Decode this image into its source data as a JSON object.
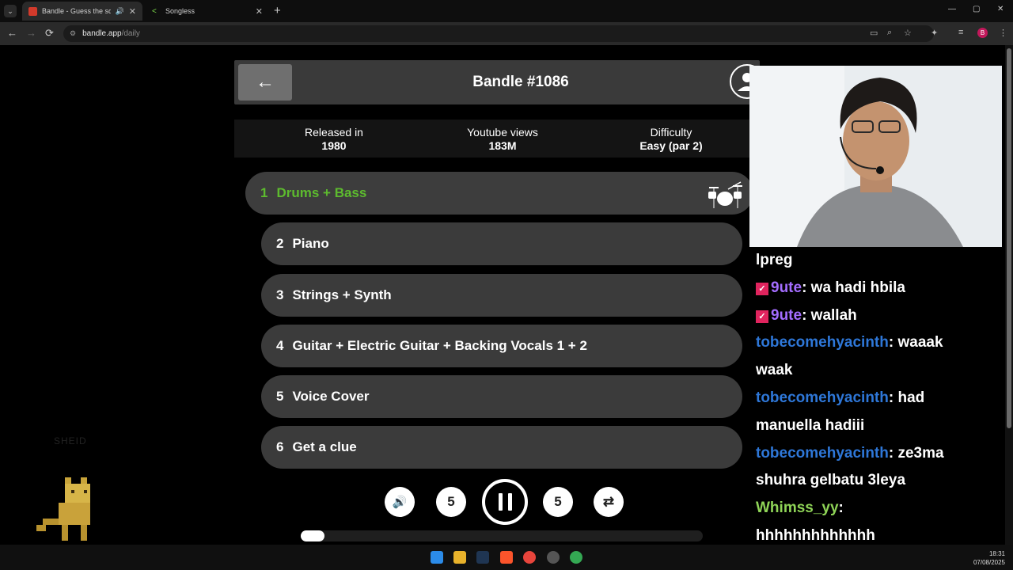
{
  "browser": {
    "tabs": [
      {
        "title": "Bandle - Guess the song, on",
        "active": true
      },
      {
        "title": "Songless",
        "active": false
      }
    ],
    "url_host": "bandle.app",
    "url_path": "/daily",
    "nav": {
      "back": "←",
      "forward": "→",
      "reload": "⟳",
      "close": "✕",
      "new_tab": "+",
      "tab_list": "⌄"
    },
    "window": {
      "minimize": "—",
      "maximize": "▢",
      "close": "✕"
    },
    "profile_initial": "B"
  },
  "game": {
    "title": "Bandle #1086",
    "back_label": "←",
    "info": [
      {
        "label": "Released in",
        "value": "1980"
      },
      {
        "label": "Youtube views",
        "value": "183M"
      },
      {
        "label": "Difficulty",
        "value": "Easy (par 2)"
      }
    ],
    "tracks": [
      {
        "num": "1",
        "label": "Drums + Bass",
        "active": true
      },
      {
        "num": "2",
        "label": "Piano",
        "active": false
      },
      {
        "num": "3",
        "label": "Strings + Synth",
        "active": false
      },
      {
        "num": "4",
        "label": "Guitar + Electric Guitar + Backing Vocals 1 + 2",
        "active": false
      },
      {
        "num": "5",
        "label": "Voice Cover",
        "active": false
      },
      {
        "num": "6",
        "label": "Get a clue",
        "active": false
      }
    ],
    "controls": {
      "volume": "🔊",
      "rewind": "5",
      "forward": "5",
      "repeat": "⇄"
    },
    "progress": 0.06
  },
  "stream": {
    "watermark": "SHEID",
    "chat": [
      {
        "segments": [
          {
            "text": "lpreg",
            "color": "white"
          }
        ]
      },
      {
        "badge": true,
        "segments": [
          {
            "text": "9ute",
            "color": "purple"
          },
          {
            "text": ":  wa hadi hbila",
            "color": "white"
          }
        ]
      },
      {
        "badge": true,
        "segments": [
          {
            "text": "9ute",
            "color": "purple"
          },
          {
            "text": ":  wallah",
            "color": "white"
          }
        ]
      },
      {
        "segments": [
          {
            "text": "tobecomehyacinth",
            "color": "blue"
          },
          {
            "text": ":  waaak",
            "color": "white"
          }
        ]
      },
      {
        "segments": [
          {
            "text": "waak",
            "color": "white"
          }
        ]
      },
      {
        "segments": [
          {
            "text": "tobecomehyacinth",
            "color": "blue"
          },
          {
            "text": ":  had",
            "color": "white"
          }
        ]
      },
      {
        "segments": [
          {
            "text": "manuella hadiii",
            "color": "white"
          }
        ]
      },
      {
        "segments": [
          {
            "text": "tobecomehyacinth",
            "color": "blue"
          },
          {
            "text": ":  ze3ma",
            "color": "white"
          }
        ]
      },
      {
        "segments": [
          {
            "text": "shuhra gelbatu 3leya",
            "color": "white"
          }
        ]
      },
      {
        "segments": [
          {
            "text": "Whimss_yy",
            "color": "green"
          },
          {
            "text": ":",
            "color": "white"
          }
        ]
      },
      {
        "segments": [
          {
            "text": "hhhhhhhhhhhhh",
            "color": "white"
          }
        ]
      }
    ]
  },
  "taskbar": {
    "time": "18:31",
    "date": "07/08/2025"
  }
}
